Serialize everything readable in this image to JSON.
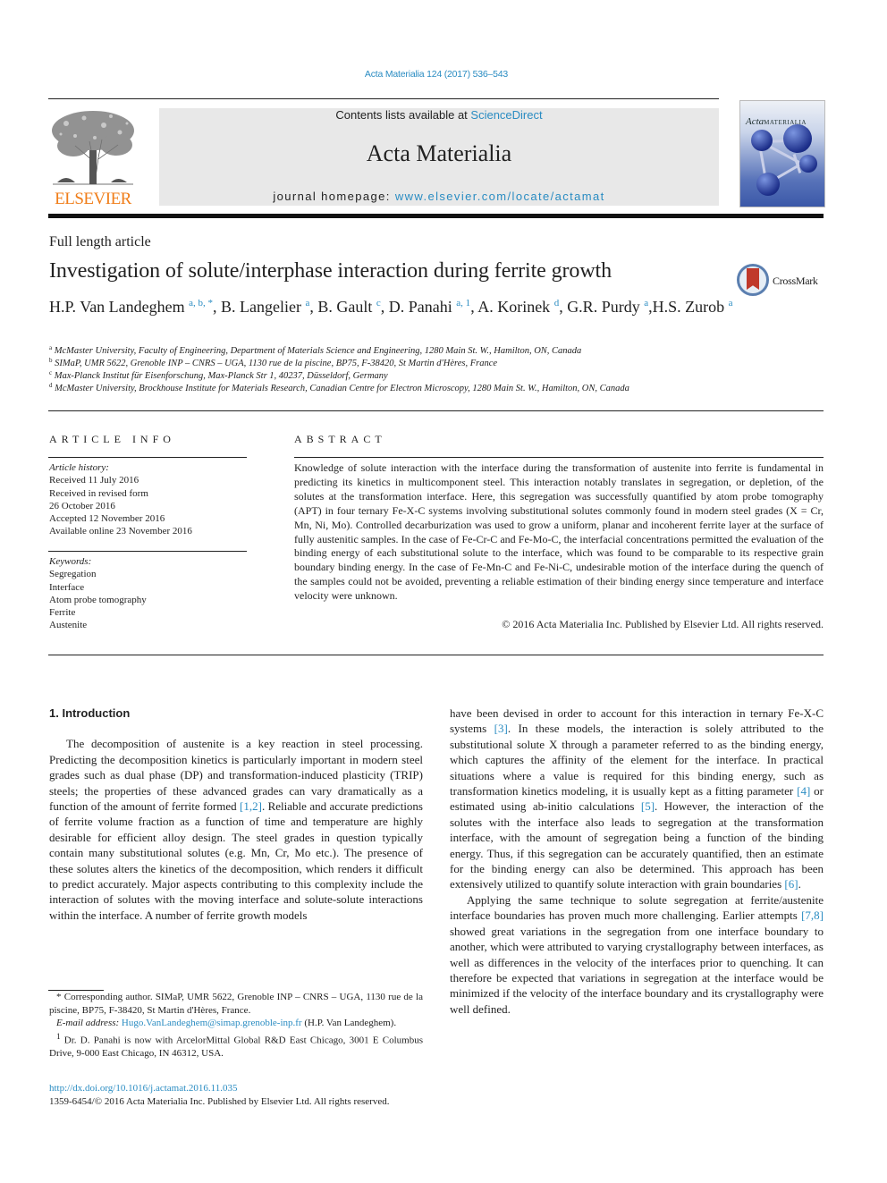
{
  "header": {
    "citation": "Acta Materialia 124 (2017) 536–543",
    "publisher_logo_text": "ELSEVIER",
    "contents_prefix": "Contents lists available at ",
    "contents_link": "ScienceDirect",
    "journal_title": "Acta Materialia",
    "homepage_prefix": "journal homepage: ",
    "homepage_link": "www.elsevier.com/locate/actamat",
    "cover_title_italic": "Acta",
    "cover_title_caps": "MATERIALIA"
  },
  "article": {
    "type": "Full length article",
    "title": "Investigation of solute/interphase interaction during ferrite growth",
    "crossmark_label": "CrossMark",
    "authors": [
      {
        "name": "H.P. Van Landeghem",
        "sup": "a, b, *",
        "sep": ", "
      },
      {
        "name": "B. Langelier",
        "sup": "a",
        "sep": ", "
      },
      {
        "name": "B. Gault",
        "sup": "c",
        "sep": ", "
      },
      {
        "name": "D. Panahi",
        "sup": "a, 1",
        "sep": ", "
      },
      {
        "name": "A. Korinek",
        "sup": "d",
        "sep": ", "
      },
      {
        "name": "G.R. Purdy",
        "sup": "a",
        "sep": ","
      },
      {
        "name": "H.S. Zurob",
        "sup": "a",
        "sep": ""
      }
    ],
    "affiliations": [
      {
        "key": "a",
        "text": "McMaster University, Faculty of Engineering, Department of Materials Science and Engineering, 1280 Main St. W., Hamilton, ON, Canada"
      },
      {
        "key": "b",
        "text": "SIMaP, UMR 5622, Grenoble INP – CNRS – UGA, 1130 rue de la piscine, BP75, F-38420, St Martin d'Hères, France"
      },
      {
        "key": "c",
        "text": "Max-Planck Institut für Eisenforschung, Max-Planck Str 1, 40237, Düsseldorf, Germany"
      },
      {
        "key": "d",
        "text": "McMaster University, Brockhouse Institute for Materials Research, Canadian Centre for Electron Microscopy, 1280 Main St. W., Hamilton, ON, Canada"
      }
    ]
  },
  "article_info": {
    "heading": "ARTICLE INFO",
    "history_label": "Article history:",
    "history": [
      "Received 11 July 2016",
      "Received in revised form",
      "26 October 2016",
      "Accepted 12 November 2016",
      "Available online 23 November 2016"
    ],
    "keywords_label": "Keywords:",
    "keywords": [
      "Segregation",
      "Interface",
      "Atom probe tomography",
      "Ferrite",
      "Austenite"
    ]
  },
  "abstract": {
    "heading": "ABSTRACT",
    "text": "Knowledge of solute interaction with the interface during the transformation of austenite into ferrite is fundamental in predicting its kinetics in multicomponent steel. This interaction notably translates in segregation, or depletion, of the solutes at the transformation interface. Here, this segregation was successfully quantified by atom probe tomography (APT) in four ternary Fe-X-C systems involving substitutional solutes commonly found in modern steel grades (X = Cr, Mn, Ni, Mo). Controlled decarburization was used to grow a uniform, planar and incoherent ferrite layer at the surface of fully austenitic samples. In the case of Fe-Cr-C and Fe-Mo-C, the interfacial concentrations permitted the evaluation of the binding energy of each substitutional solute to the interface, which was found to be comparable to its respective grain boundary binding energy. In the case of Fe-Mn-C and Fe-Ni-C, undesirable motion of the interface during the quench of the samples could not be avoided, preventing a reliable estimation of their binding energy since temperature and interface velocity were unknown.",
    "copyright": "© 2016 Acta Materialia Inc. Published by Elsevier Ltd. All rights reserved."
  },
  "body": {
    "section_heading": "1.  Introduction",
    "left_para1": [
      {
        "t": "The decomposition of austenite is a key reaction in steel processing. Predicting the decomposition kinetics is particularly important in modern steel grades such as dual phase (DP) and transformation-induced plasticity (TRIP) steels; the properties of these advanced grades can vary dramatically as a function of the amount of ferrite formed "
      },
      {
        "ref": "[1,2]"
      },
      {
        "t": ". Reliable and accurate predictions of ferrite volume fraction as a function of time and temperature are highly desirable for efficient alloy design. The steel grades in question typically contain many substitutional solutes (e.g. Mn, Cr, Mo etc.). The presence of these solutes alters the kinetics of the decomposition, which renders it difficult to predict accurately. Major aspects contributing to this complexity include the interaction of solutes with the moving interface and solute-solute interactions within the interface. A number of ferrite growth models"
      }
    ],
    "right_para1": [
      {
        "t": "have been devised in order to account for this interaction in ternary Fe-X-C systems "
      },
      {
        "ref": "[3]"
      },
      {
        "t": ". In these models, the interaction is solely attributed to the substitutional solute X through a parameter referred to as the binding energy, which captures the affinity of the element for the interface. In practical situations where a value is required for this binding energy, such as transformation kinetics modeling, it is usually kept as a fitting parameter "
      },
      {
        "ref": "[4]"
      },
      {
        "t": " or estimated using ab-initio calculations "
      },
      {
        "ref": "[5]"
      },
      {
        "t": ". However, the interaction of the solutes with the interface also leads to segregation at the transformation interface, with the amount of segregation being a function of the binding energy. Thus, if this segregation can be accurately quantified, then an estimate for the binding energy can also be determined. This approach has been extensively utilized to quantify solute interaction with grain boundaries "
      },
      {
        "ref": "[6]"
      },
      {
        "t": "."
      }
    ],
    "right_para2": [
      {
        "t": "Applying the same technique to solute segregation at ferrite/austenite interface boundaries has proven much more challenging. Earlier attempts "
      },
      {
        "ref": "[7,8]"
      },
      {
        "t": " showed great variations in the segregation from one interface boundary to another, which were attributed to varying crystallography between interfaces, as well as differences in the velocity of the interfaces prior to quenching. It can therefore be expected that variations in segregation at the interface would be minimized if the velocity of the interface boundary and its crystallography were well defined."
      }
    ]
  },
  "footnotes": {
    "corresponding": "* Corresponding author. SIMaP, UMR 5622, Grenoble INP – CNRS – UGA, 1130 rue de la piscine, BP75, F-38420, St Martin d'Hères, France.",
    "email_label": "E-mail address:",
    "email": "Hugo.VanLandeghem@simap.grenoble-inp.fr",
    "email_suffix": " (H.P. Van Landeghem).",
    "note1_mark": "1",
    "note1": " Dr. D. Panahi is now with ArcelorMittal Global R&D East Chicago, 3001 E Columbus Drive, 9-000 East Chicago, IN 46312, USA.",
    "doi": "http://dx.doi.org/10.1016/j.actamat.2016.11.035",
    "issn": "1359-6454/© 2016 Acta Materialia Inc. Published by Elsevier Ltd. All rights reserved."
  },
  "colors": {
    "link": "#2a8cc2",
    "elsevier_orange": "#f07d19",
    "journal_box": "#e8e8e8"
  }
}
